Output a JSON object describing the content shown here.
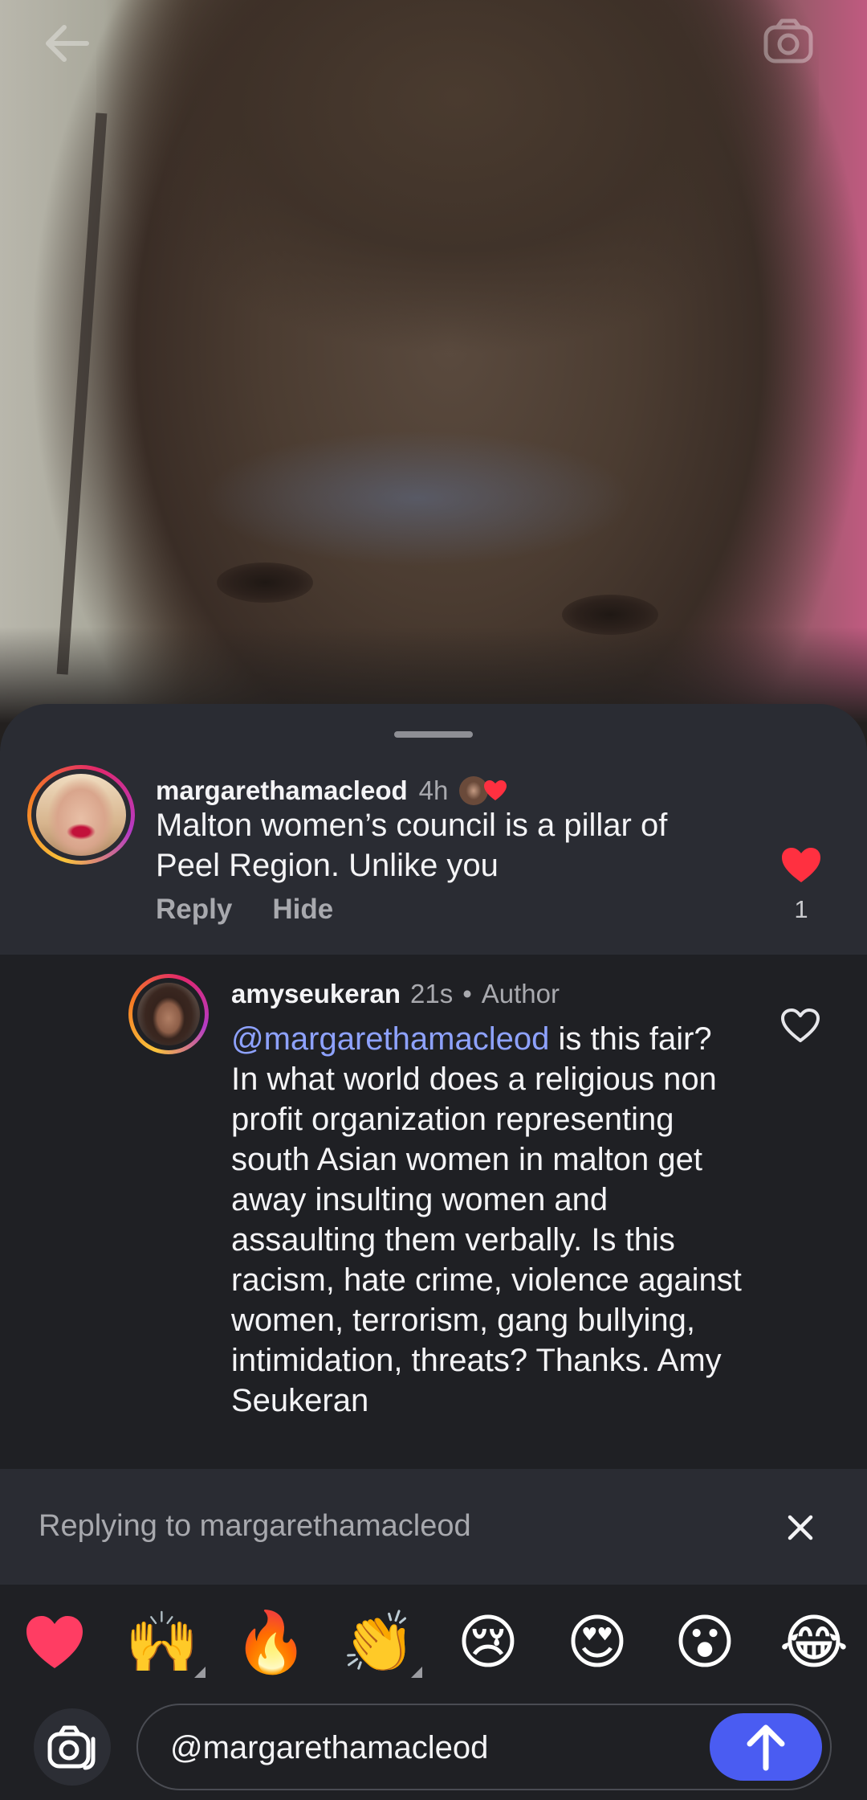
{
  "video": {
    "back_icon": "back-arrow-icon",
    "camera_icon": "camera-icon"
  },
  "comments": [
    {
      "username": "margarethamacleod",
      "time": "4h",
      "text": "Malton women’s council is a pillar of Peel Region. Unlike you",
      "actions": [
        "Reply",
        "Hide"
      ],
      "like_count": "1",
      "liked": true,
      "liked_by_author_icon": "liked-by-author-icon"
    },
    {
      "username": "amyseukeran",
      "time": "21s",
      "separator": "•",
      "badge": "Author",
      "mention": "@margarethamacleod",
      "text": " is this fair? In what world does a religious non profit organization representing south Asian women in malton get away insulting women and assaulting them verbally. Is this racism, hate crime, violence against women, terrorism, gang bullying, intimidation, threats? Thanks. Amy Seukeran",
      "liked": false
    }
  ],
  "reply_banner": {
    "label": "Replying to margarethamacleod"
  },
  "emoji_bar": [
    {
      "name": "heart",
      "glyph": "❤️",
      "has_variants": false
    },
    {
      "name": "raising-hands",
      "glyph": "🙌",
      "has_variants": true
    },
    {
      "name": "fire",
      "glyph": "🔥",
      "has_variants": false
    },
    {
      "name": "clapping-hands",
      "glyph": "👏",
      "has_variants": true
    },
    {
      "name": "crying-face",
      "glyph": "😢",
      "has_variants": false
    },
    {
      "name": "heart-eyes",
      "glyph": "😍",
      "has_variants": false
    },
    {
      "name": "surprised-face",
      "glyph": "😮",
      "has_variants": false
    },
    {
      "name": "tears-of-joy",
      "glyph": "😂",
      "has_variants": false
    }
  ],
  "composer": {
    "value": "@margarethamacleod",
    "send_icon": "send-arrow-icon",
    "camera_icon": "camera-icon"
  },
  "colors": {
    "accent": "#4a5cf2",
    "mention": "#8ea2ff",
    "like_red": "#ff3040",
    "sheet_bg": "#2a2c33",
    "reply_bg": "#1f2024"
  }
}
